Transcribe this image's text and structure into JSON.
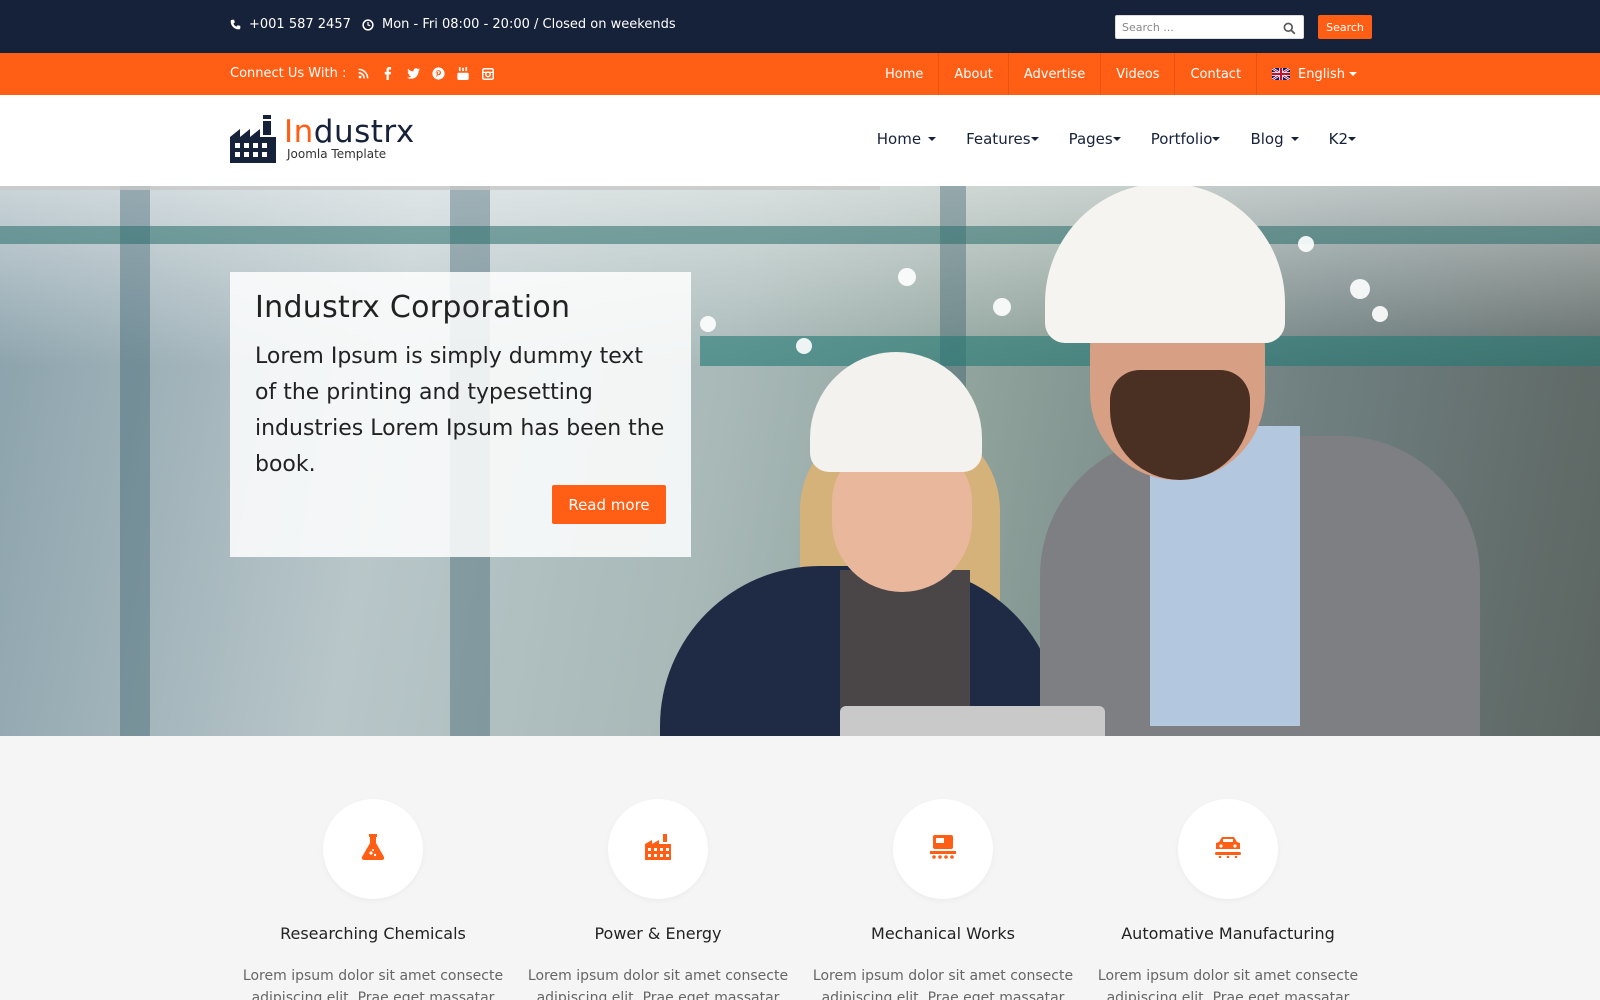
{
  "colors": {
    "navy": "#16213a",
    "orange": "#ff5e14",
    "light_bg": "#f5f5f5"
  },
  "topbar": {
    "phone": "+001 587 2457",
    "phone_icon": "phone-icon",
    "hours": "Mon - Fri 08:00 - 20:00 / Closed on weekends",
    "hours_icon": "clock-icon",
    "search_placeholder": "Search ...",
    "search_button": "Search"
  },
  "social_bar": {
    "connect_label": "Connect Us With :",
    "icons": [
      "rss-icon",
      "facebook-icon",
      "twitter-icon",
      "pinterest-icon",
      "youtube-icon",
      "instagram-icon"
    ],
    "nav": [
      "Home",
      "About",
      "Advertise",
      "Videos",
      "Contact"
    ],
    "language": "English"
  },
  "header": {
    "logo_accent": "In",
    "logo_rest": "dustrx",
    "logo_sub": "Joomla Template",
    "nav": [
      "Home",
      "Features",
      "Pages",
      "Portfolio",
      "Blog",
      "K2"
    ]
  },
  "hero": {
    "title": "Industrx Corporation",
    "text": "Lorem Ipsum is simply dummy text of the printing and typesetting industries Lorem Ipsum has been the book.",
    "button": "Read more"
  },
  "services": [
    {
      "icon": "chemical-flask-icon",
      "title": "Researching Chemicals",
      "text": "Lorem ipsum dolor sit amet consecte adipiscing elit. Prae eget massatar"
    },
    {
      "icon": "factory-icon",
      "title": "Power & Energy",
      "text": "Lorem ipsum dolor sit amet consecte adipiscing elit. Prae eget massatar"
    },
    {
      "icon": "machine-icon",
      "title": "Mechanical Works",
      "text": "Lorem ipsum dolor sit amet consecte adipiscing elit. Prae eget massatar"
    },
    {
      "icon": "car-conveyor-icon",
      "title": "Automative Manufacturing",
      "text": "Lorem ipsum dolor sit amet consecte adipiscing elit. Prae eget massatar"
    }
  ]
}
